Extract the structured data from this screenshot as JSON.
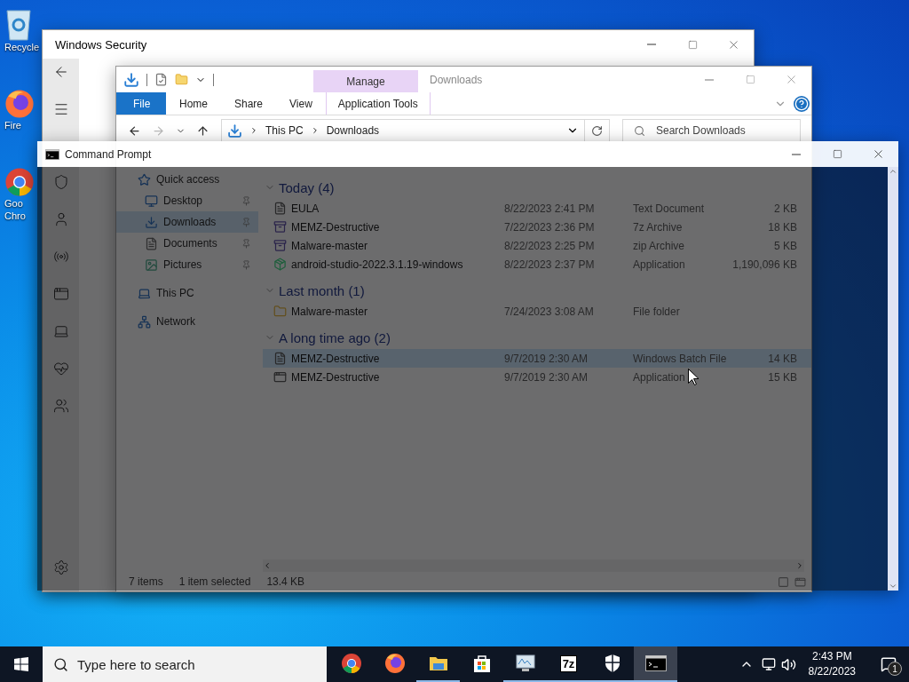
{
  "desktop_icons": [
    {
      "kind": "recycle-bin",
      "lines": [
        "Recycle"
      ]
    },
    {
      "kind": "firefox",
      "lines": [
        "Fire"
      ]
    },
    {
      "kind": "chrome",
      "lines": [
        "Goo",
        "Chro"
      ]
    }
  ],
  "security_window": {
    "title": "Windows Security",
    "nav": [
      {
        "kind": "back"
      },
      {
        "kind": "menu"
      },
      {
        "kind": "shield"
      },
      {
        "kind": "account"
      },
      {
        "kind": "network"
      },
      {
        "kind": "app"
      },
      {
        "kind": "device"
      },
      {
        "kind": "health"
      },
      {
        "kind": "family"
      },
      {
        "kind": "settings"
      }
    ]
  },
  "explorer": {
    "title": "Downloads",
    "context_group": "Manage",
    "ribbon_tabs": [
      {
        "label": "File",
        "kind": "file"
      },
      {
        "label": "Home",
        "kind": "plain"
      },
      {
        "label": "Share",
        "kind": "plain"
      },
      {
        "label": "View",
        "kind": "plain"
      },
      {
        "label": "Application Tools",
        "kind": "context"
      }
    ],
    "path": [
      "This PC",
      "Downloads"
    ],
    "search": {
      "placeholder": "Search Downloads"
    },
    "nav": [
      {
        "label": "Quick access",
        "kind": "star",
        "selected": false,
        "children": [
          {
            "label": "Desktop",
            "kind": "desktop",
            "selected": false,
            "pinned": true
          },
          {
            "label": "Downloads",
            "kind": "download",
            "selected": true,
            "pinned": true
          },
          {
            "label": "Documents",
            "kind": "documents",
            "selected": false,
            "pinned": true
          },
          {
            "label": "Pictures",
            "kind": "pictures",
            "selected": false,
            "pinned": true
          }
        ]
      },
      {
        "label": "This PC",
        "kind": "pc",
        "selected": false
      },
      {
        "label": "Network",
        "kind": "network",
        "selected": false
      }
    ],
    "groups": [
      {
        "label": "Today (4)",
        "expanded": true,
        "files": [
          {
            "name": "EULA",
            "date": "8/22/2023 2:41 PM",
            "type": "Text Document",
            "size": "2 KB",
            "kind": "text",
            "selected": false
          },
          {
            "name": "MEMZ-Destructive",
            "date": "7/22/2023 2:36 PM",
            "type": "7z Archive",
            "size": "18 KB",
            "kind": "archive",
            "selected": false
          },
          {
            "name": "Malware-master",
            "date": "8/22/2023 2:25 PM",
            "type": "zip Archive",
            "size": "5 KB",
            "kind": "archive",
            "selected": false
          },
          {
            "name": "android-studio-2022.3.1.19-windows",
            "date": "8/22/2023 2:37 PM",
            "type": "Application",
            "size": "1,190,096 KB",
            "kind": "installer",
            "selected": false
          }
        ]
      },
      {
        "label": "Last month (1)",
        "expanded": true,
        "files": [
          {
            "name": "Malware-master",
            "date": "7/24/2023 3:08 AM",
            "type": "File folder",
            "kind": "folder",
            "selected": false
          }
        ]
      },
      {
        "label": "A long time ago (2)",
        "expanded": true,
        "files": [
          {
            "name": "MEMZ-Destructive",
            "date": "9/7/2019 2:30 AM",
            "type": "Windows Batch File",
            "size": "14 KB",
            "kind": "text",
            "selected": true
          },
          {
            "name": "MEMZ-Destructive",
            "date": "9/7/2019 2:30 AM",
            "type": "Application",
            "size": "15 KB",
            "kind": "app",
            "selected": false
          }
        ]
      }
    ],
    "status": {
      "count": "7 items",
      "selection": "1 item selected",
      "selection_size": "13.4 KB"
    }
  },
  "command_prompt": {
    "title": "Command Prompt"
  },
  "taskbar": {
    "search_placeholder": "Type here to search",
    "apps": [
      {
        "kind": "chrome",
        "running": false,
        "active": false
      },
      {
        "kind": "firefox",
        "running": false,
        "active": false
      },
      {
        "kind": "explorer",
        "running": true,
        "active": false
      },
      {
        "kind": "store",
        "running": false,
        "active": false
      },
      {
        "kind": "monitor",
        "running": true,
        "active": false
      },
      {
        "kind": "archiver",
        "label": "7z",
        "running": true,
        "active": false
      },
      {
        "kind": "shield",
        "running": true,
        "active": false
      },
      {
        "kind": "console",
        "running": true,
        "active": true
      }
    ],
    "time": "2:43 PM",
    "date": "8/22/2023",
    "notifications": "1"
  }
}
